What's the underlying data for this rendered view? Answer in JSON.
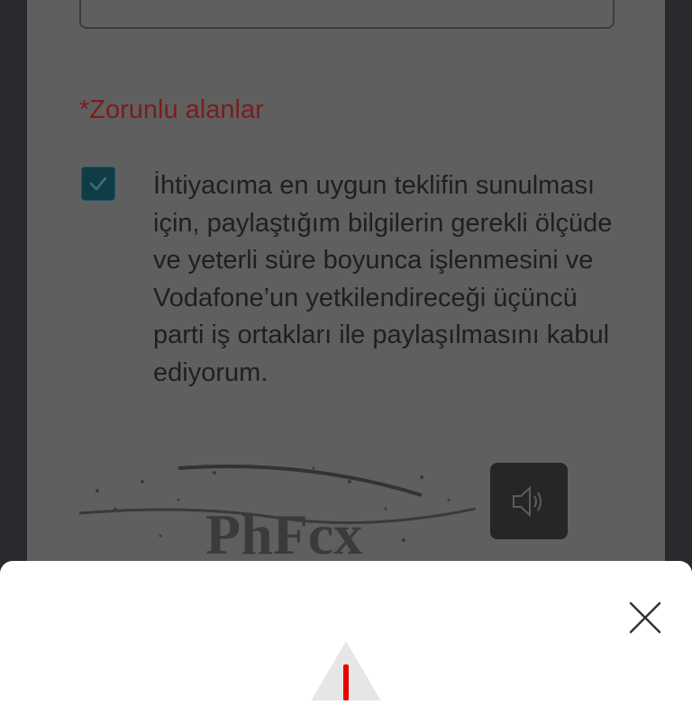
{
  "form": {
    "required_note": "*Zorunlu alanlar",
    "consent_checked": true,
    "consent_text": "İhtiyacıma en uygun teklifin sunulması için, paylaştığım bilgilerin gerekli ölçüde ve yeterli süre boyunca işlenmesini ve Vodafone’un yetkilendireceği üçüncü parti iş ortakları ile paylaşılmasını kabul ediyorum."
  },
  "captcha": {
    "text": "PhFcx"
  },
  "icons": {
    "check": "check-icon",
    "audio": "speaker-icon",
    "close": "close-icon",
    "warning": "warning-icon"
  },
  "colors": {
    "required_text": "#7a1d1d",
    "checkbox_fill": "#0f3c45",
    "warning_red": "#e60000"
  }
}
